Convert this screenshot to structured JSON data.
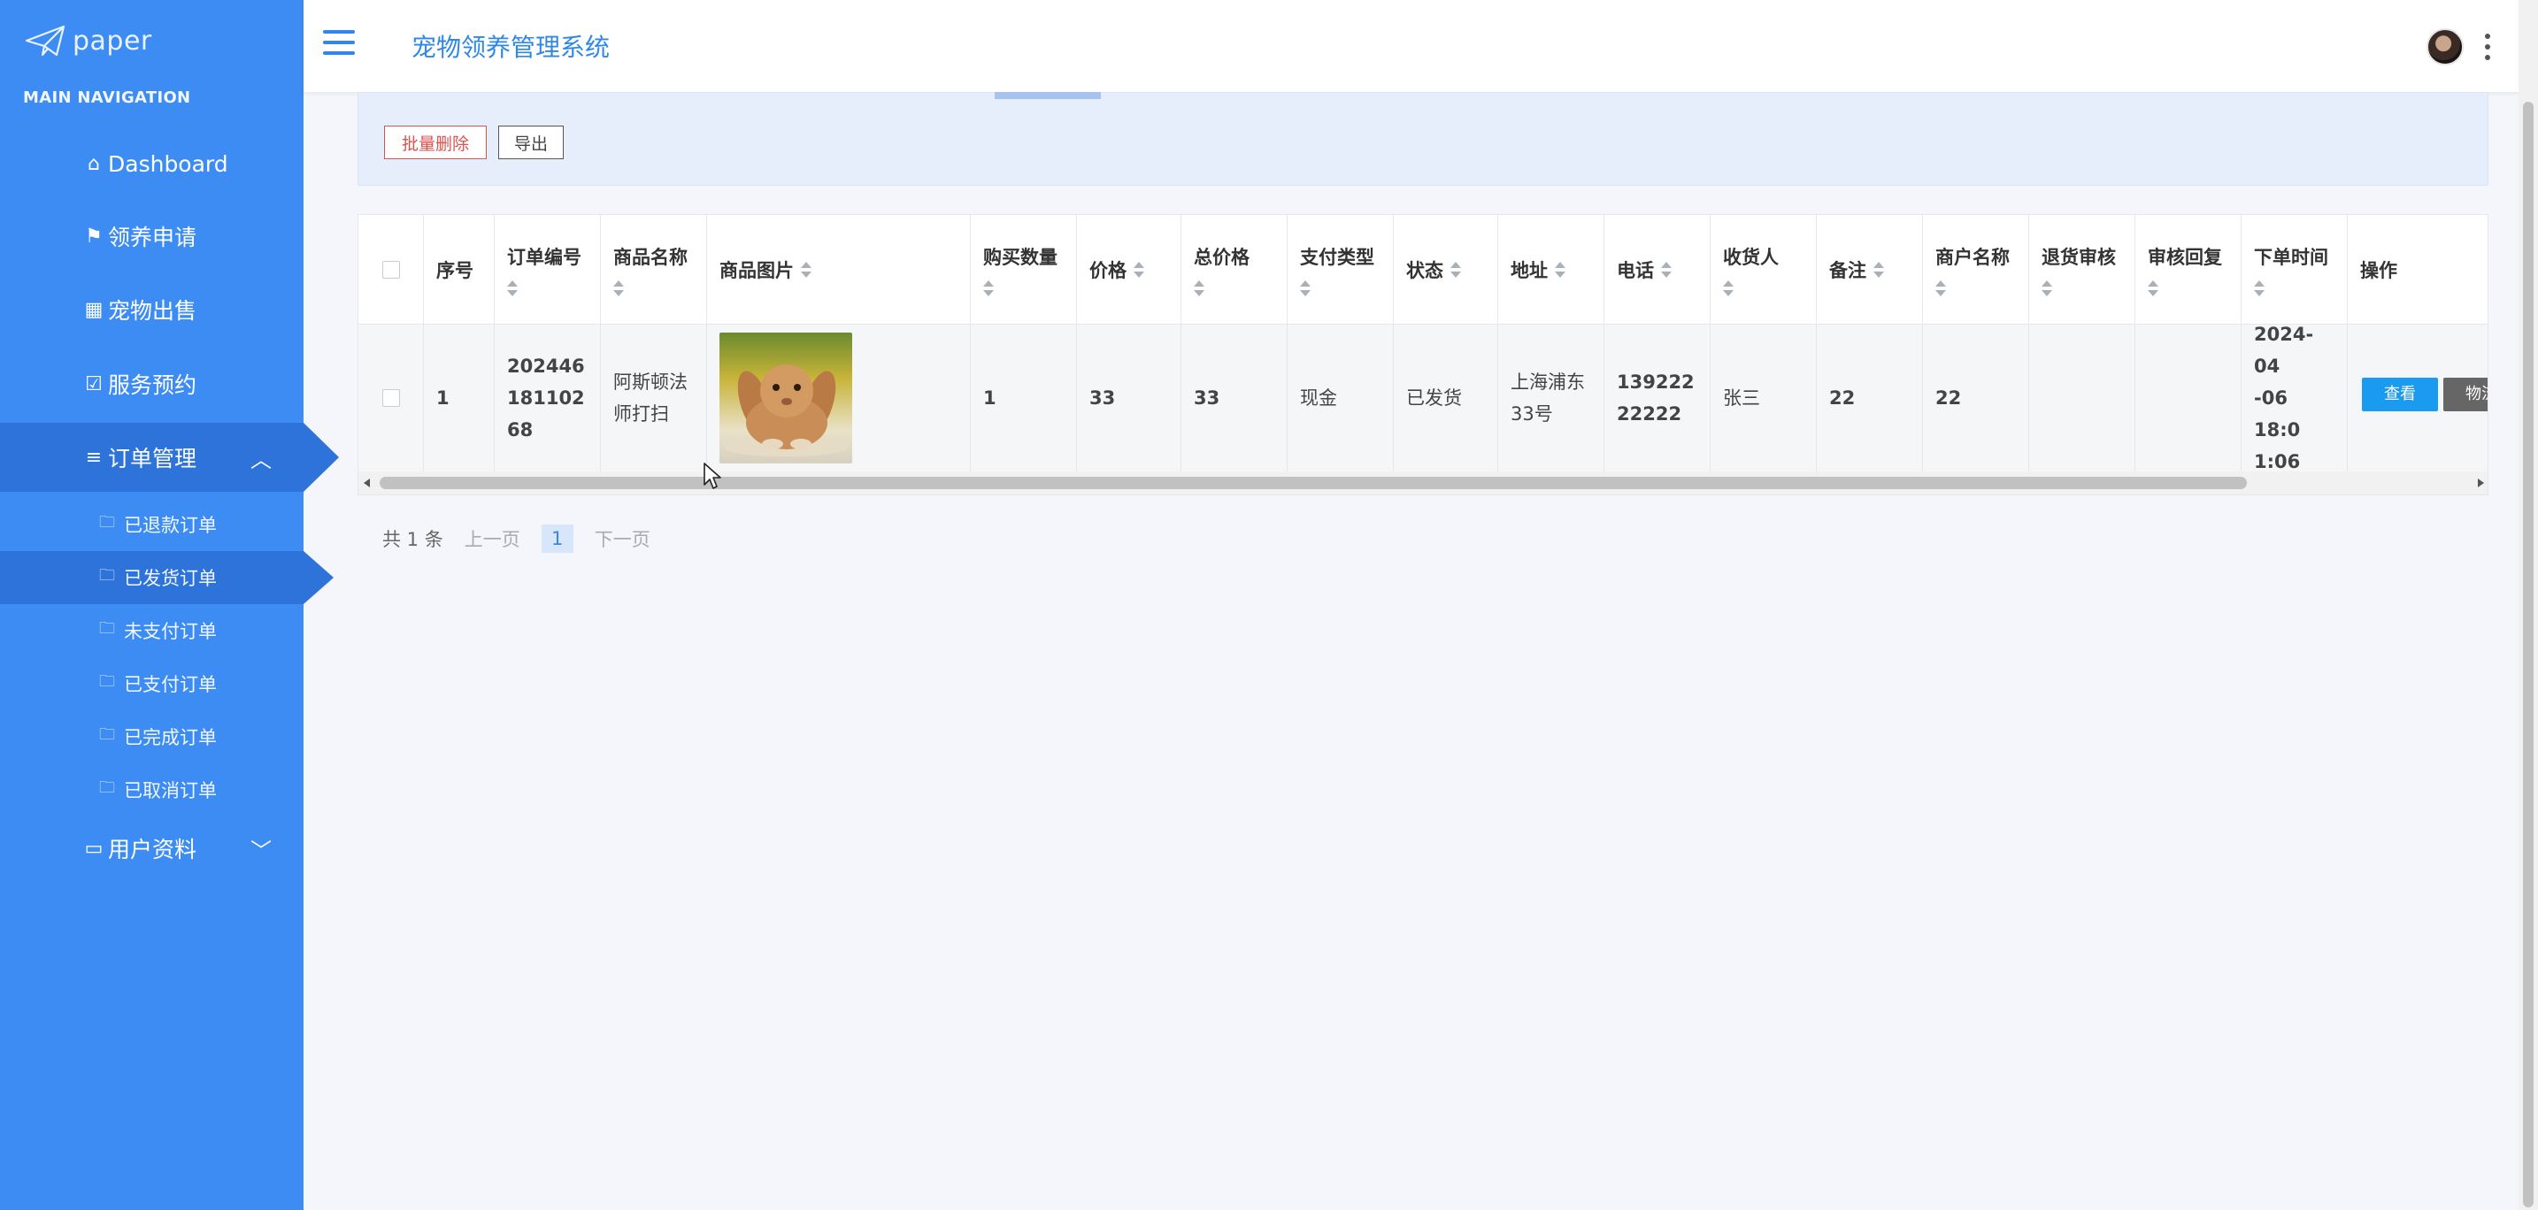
{
  "brand": {
    "name": "paper"
  },
  "sidebar": {
    "header": "MAIN NAVIGATION",
    "items": [
      {
        "label": "Dashboard",
        "icon": "home-icon"
      },
      {
        "label": "领养申请",
        "icon": "flag-icon"
      },
      {
        "label": "宠物出售",
        "icon": "grid-icon"
      },
      {
        "label": "服务预约",
        "icon": "check-square-icon"
      },
      {
        "label": "订单管理",
        "icon": "list-icon",
        "expanded": true
      },
      {
        "label": "用户资料",
        "icon": "card-icon",
        "expanded": false
      }
    ],
    "sub_items": [
      {
        "label": "已退款订单"
      },
      {
        "label": "已发货订单",
        "active": true
      },
      {
        "label": "未支付订单"
      },
      {
        "label": "已支付订单"
      },
      {
        "label": "已完成订单"
      },
      {
        "label": "已取消订单"
      }
    ]
  },
  "header": {
    "title": "宠物领养管理系统"
  },
  "toolbar": {
    "batch_delete": "批量删除",
    "export": "导出"
  },
  "table": {
    "columns": [
      "序号",
      "订单编号",
      "商品名称",
      "商品图片",
      "购买数量",
      "价格",
      "总价格",
      "支付类型",
      "状态",
      "地址",
      "电话",
      "收货人",
      "备注",
      "商户名称",
      "退货审核",
      "审核回复",
      "下单时间",
      "操作"
    ],
    "rows": [
      {
        "index": "1",
        "order_no": [
          "202446",
          "181102",
          "68"
        ],
        "product_name": [
          "阿斯顿法",
          "师打扫"
        ],
        "image": "rabbit-photo",
        "quantity": "1",
        "price": "33",
        "total": "33",
        "pay_type": "现金",
        "status": "已发货",
        "address": [
          "上海浦东",
          "33号"
        ],
        "phone": [
          "139222",
          "22222"
        ],
        "receiver": "张三",
        "remark": "22",
        "merchant": "22",
        "return_review": "",
        "review_reply": "",
        "order_time": [
          "2024-04",
          "-06 18:0",
          "1:06"
        ],
        "actions": {
          "view": "查看",
          "logistics": "物流"
        }
      }
    ]
  },
  "pager": {
    "total": "共 1 条",
    "prev": "上一页",
    "current": "1",
    "next": "下一页"
  },
  "colors": {
    "sidebar_bg": "#3c8cf3",
    "sidebar_active": "#2d73da",
    "accent": "#2f87e8",
    "danger": "#d9534f",
    "view_btn": "#1a9bf0"
  }
}
